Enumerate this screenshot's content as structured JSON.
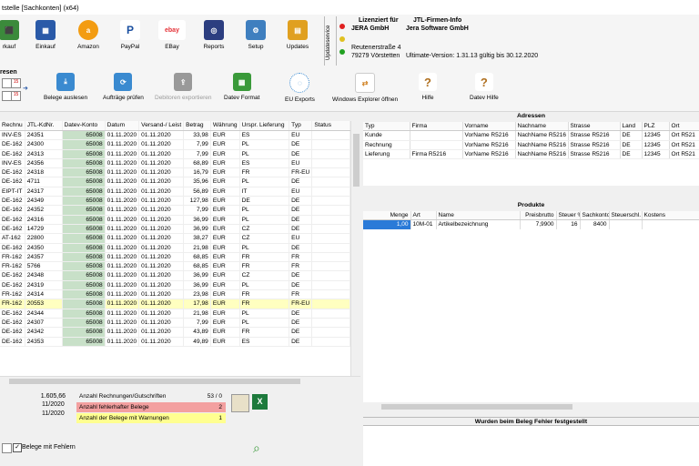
{
  "window": {
    "title": "tstelle [Sachkonten] (x64)"
  },
  "ribbon": {
    "buttons": [
      "rkauf",
      "Einkauf",
      "Amazon",
      "PayPal",
      "EBay",
      "Reports",
      "Setup",
      "Updates"
    ],
    "update_service": "Updateservice",
    "license": {
      "label": "Lizenziert für",
      "company": "JERA GmbH",
      "street": "Reutenerstraße 4",
      "city": "79279 Vörstetten",
      "info_label": "JTL-Firmen-Info",
      "info_company": "Jera Software GmbH",
      "version": "Ultimate-Version: 1.31.13 gültig bis 30.12.2020"
    }
  },
  "ribbon2": {
    "section_label": "resen",
    "date_icon": "15",
    "buttons": [
      "Belege auslesen",
      "Aufträge prüfen",
      "Debitoren exportieren",
      "Datev Format",
      "EU Exports",
      "Windows Explorer öffnen",
      "Hilfe",
      "Datev Hilfe"
    ]
  },
  "grid": {
    "headers": [
      "Rechnu",
      "JTL-KdNr.",
      "Datev-Konto",
      "Datum",
      "Versand-/ Leist",
      "Betrag",
      "Währung",
      "Urspr. Lieferung",
      "Typ",
      "Status"
    ],
    "rows": [
      [
        "INV-ES",
        "24351",
        "65008",
        "01.11.2020",
        "01.11.2020",
        "33,98",
        "EUR",
        "ES",
        "EU",
        ""
      ],
      [
        "DE-162",
        "24300",
        "65008",
        "01.11.2020",
        "01.11.2020",
        "7,99",
        "EUR",
        "PL",
        "DE",
        ""
      ],
      [
        "DE-162",
        "24313",
        "65008",
        "01.11.2020",
        "01.11.2020",
        "7,99",
        "EUR",
        "PL",
        "DE",
        ""
      ],
      [
        "INV-ES",
        "24356",
        "65008",
        "01.11.2020",
        "01.11.2020",
        "68,89",
        "EUR",
        "ES",
        "EU",
        ""
      ],
      [
        "DE-162",
        "24318",
        "65008",
        "01.11.2020",
        "01.11.2020",
        "16,79",
        "EUR",
        "FR",
        "FR-EU",
        ""
      ],
      [
        "DE-162",
        "4711",
        "65008",
        "01.11.2020",
        "01.11.2020",
        "35,96",
        "EUR",
        "PL",
        "DE",
        ""
      ],
      [
        "EIPT-IT",
        "24317",
        "65008",
        "01.11.2020",
        "01.11.2020",
        "56,89",
        "EUR",
        "IT",
        "EU",
        ""
      ],
      [
        "DE-162",
        "24349",
        "65008",
        "01.11.2020",
        "01.11.2020",
        "127,98",
        "EUR",
        "DE",
        "DE",
        ""
      ],
      [
        "DE-162",
        "24352",
        "65008",
        "01.11.2020",
        "01.11.2020",
        "7,99",
        "EUR",
        "PL",
        "DE",
        ""
      ],
      [
        "DE-162",
        "24316",
        "65008",
        "01.11.2020",
        "01.11.2020",
        "36,99",
        "EUR",
        "PL",
        "DE",
        ""
      ],
      [
        "DE-162",
        "14729",
        "65008",
        "01.11.2020",
        "01.11.2020",
        "36,99",
        "EUR",
        "CZ",
        "DE",
        ""
      ],
      [
        "AT-162",
        "22800",
        "65008",
        "01.11.2020",
        "01.11.2020",
        "38,27",
        "EUR",
        "CZ",
        "EU",
        ""
      ],
      [
        "DE-162",
        "24350",
        "65008",
        "01.11.2020",
        "01.11.2020",
        "21,98",
        "EUR",
        "PL",
        "DE",
        ""
      ],
      [
        "FR-162",
        "24357",
        "65008",
        "01.11.2020",
        "01.11.2020",
        "68,85",
        "EUR",
        "FR",
        "FR",
        ""
      ],
      [
        "FR-162",
        "5766",
        "65008",
        "01.11.2020",
        "01.11.2020",
        "68,85",
        "EUR",
        "FR",
        "FR",
        ""
      ],
      [
        "DE-162",
        "24348",
        "65008",
        "01.11.2020",
        "01.11.2020",
        "36,99",
        "EUR",
        "CZ",
        "DE",
        ""
      ],
      [
        "DE-162",
        "24319",
        "65008",
        "01.11.2020",
        "01.11.2020",
        "36,99",
        "EUR",
        "PL",
        "DE",
        ""
      ],
      [
        "FR-162",
        "24314",
        "65008",
        "01.11.2020",
        "01.11.2020",
        "23,98",
        "EUR",
        "FR",
        "FR",
        ""
      ],
      [
        "FR-162",
        "20553",
        "65008",
        "01.11.2020",
        "01.11.2020",
        "17,98",
        "EUR",
        "FR",
        "FR-EU",
        ""
      ],
      [
        "DE-162",
        "24344",
        "65008",
        "01.11.2020",
        "01.11.2020",
        "21,98",
        "EUR",
        "PL",
        "DE",
        ""
      ],
      [
        "DE-162",
        "24307",
        "65008",
        "01.11.2020",
        "01.11.2020",
        "7,99",
        "EUR",
        "PL",
        "DE",
        ""
      ],
      [
        "DE-162",
        "24342",
        "65008",
        "01.11.2020",
        "01.11.2020",
        "43,89",
        "EUR",
        "FR",
        "DE",
        ""
      ],
      [
        "DE-162",
        "24353",
        "65008",
        "01.11.2020",
        "01.11.2020",
        "49,89",
        "EUR",
        "ES",
        "DE",
        ""
      ]
    ],
    "selected_index": 18
  },
  "addresses": {
    "title": "Adressen",
    "headers": [
      "Typ",
      "Firma",
      "Vorname",
      "Nachname",
      "Strasse",
      "Land",
      "PLZ",
      "Ort"
    ],
    "rows": [
      [
        "Kunde",
        "",
        "VorName R5216",
        "NachName R5216",
        "Strasse R5216",
        "DE",
        "12345",
        "Ort R521"
      ],
      [
        "Rechnung",
        "",
        "VorName R5216",
        "NachName R5216",
        "Strasse R5216",
        "DE",
        "12345",
        "Ort R521"
      ],
      [
        "Lieferung",
        "Firma R5216",
        "VorName R5216",
        "NachName R5216",
        "Strasse R5216",
        "DE",
        "12345",
        "Ort R521"
      ]
    ]
  },
  "products": {
    "title": "Produkte",
    "headers": [
      "Menge",
      "Art",
      "Name",
      "Preisbrutto",
      "Steuer %",
      "Sachkonto",
      "Steuerschl.",
      "Kostens"
    ],
    "rows": [
      [
        "1,00",
        "10M-01",
        "Artikelbezeichnung",
        "7,9900",
        "16",
        "8400",
        "",
        ""
      ]
    ]
  },
  "errors": {
    "title": "Wurden beim Beleg Fehler festgestellt"
  },
  "summary": {
    "total": "1.605,66",
    "date_from": "11/2020",
    "date_to": "11/2020",
    "count_label": "Anzahl Rechnungen/Gutschriften",
    "count_value": "53 / 0",
    "error_label": "Anzahl fehlerhafter Belege",
    "error_value": "2",
    "warn_label": "Anzahl der Belege mit Warnungen",
    "warn_value": "1",
    "checkbox_label": "Belege mit Fehlern"
  }
}
